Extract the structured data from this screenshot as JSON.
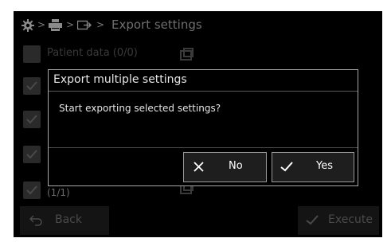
{
  "header": {
    "icons": [
      "gear-icon",
      "printer-icon",
      "export-icon"
    ],
    "separator": ">",
    "title": "Export settings"
  },
  "list": {
    "first_row_label": "Patient data (0/0)",
    "last_row_count": "(1/1)"
  },
  "footer": {
    "back_label": "Back",
    "execute_label": "Execute"
  },
  "dialog": {
    "title": "Export multiple settings",
    "message": "Start exporting selected settings?",
    "no_label": "No",
    "yes_label": "Yes"
  },
  "colors": {
    "screen_bg": "#000000",
    "dialog_border": "#a8a8a8",
    "dimmed_text": "#3a3a3a"
  }
}
